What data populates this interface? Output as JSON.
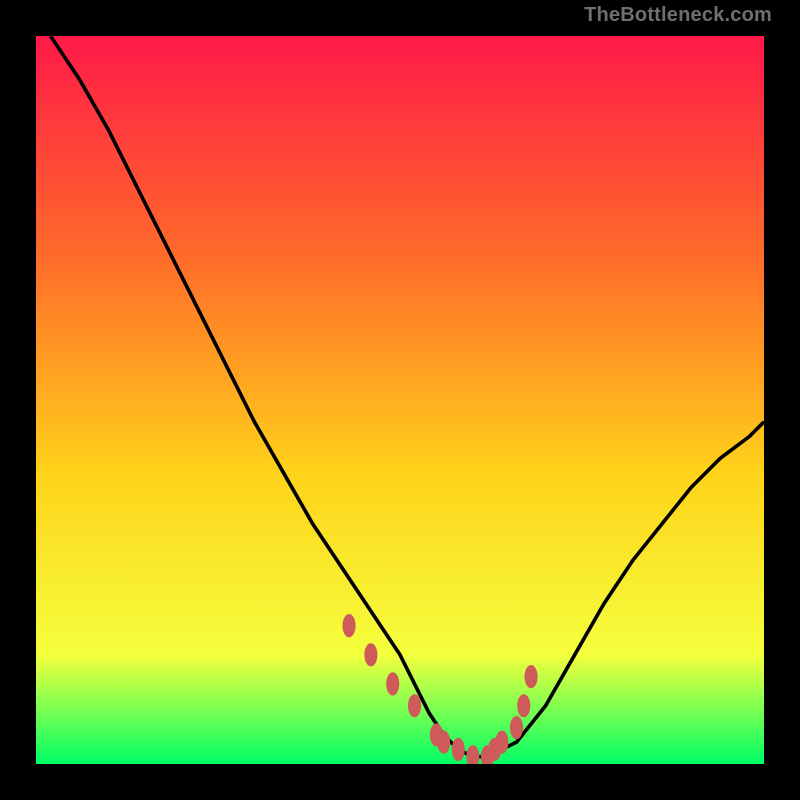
{
  "watermark": "TheBottleneck.com",
  "colors": {
    "gradient_top": "#ff1a48",
    "gradient_upper_mid": "#ff6a2a",
    "gradient_mid": "#ffd21a",
    "gradient_lower_mid": "#f4ff3d",
    "gradient_bottom": "#00ff66",
    "curve": "#000000",
    "points": "#cf5a5a",
    "frame": "#000000"
  },
  "chart_data": {
    "type": "line",
    "title": "",
    "xlabel": "",
    "ylabel": "",
    "xlim": [
      0,
      100
    ],
    "ylim": [
      0,
      100
    ],
    "series": [
      {
        "name": "bottleneck-curve",
        "x": [
          2,
          6,
          10,
          14,
          18,
          22,
          26,
          30,
          34,
          38,
          42,
          46,
          50,
          52,
          54,
          56,
          58,
          60,
          62,
          66,
          70,
          74,
          78,
          82,
          86,
          90,
          94,
          98,
          100
        ],
        "y": [
          100,
          94,
          87,
          79,
          71,
          63,
          55,
          47,
          40,
          33,
          27,
          21,
          15,
          11,
          7,
          4,
          2,
          1,
          1,
          3,
          8,
          15,
          22,
          28,
          33,
          38,
          42,
          45,
          47
        ]
      }
    ],
    "scatter_points": {
      "name": "highlighted-points",
      "x": [
        43,
        46,
        49,
        52,
        55,
        56,
        58,
        60,
        62,
        63,
        64,
        66,
        67,
        68
      ],
      "y": [
        19,
        15,
        11,
        8,
        4,
        3,
        2,
        1,
        1,
        2,
        3,
        5,
        8,
        12
      ]
    }
  }
}
